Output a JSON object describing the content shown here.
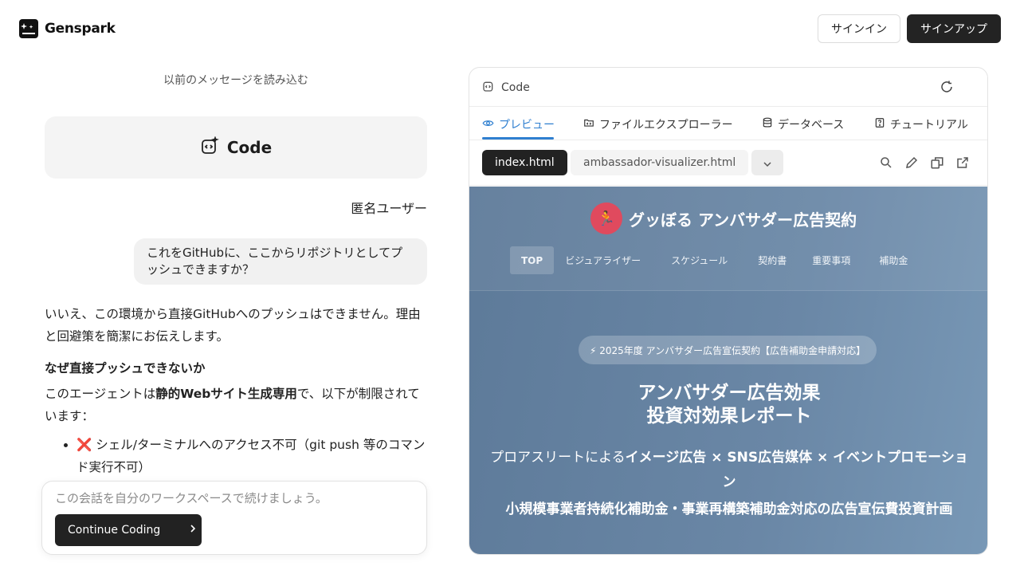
{
  "header": {
    "brand": "Genspark",
    "signin": "サインイン",
    "signup": "サインアップ"
  },
  "chat": {
    "load_previous": "以前のメッセージを読み込む",
    "code_card_label": "Code",
    "user_name": "匿名ユーザー",
    "user_message": "これをGitHubに、ここからリポジトリとしてプッシュできますか？",
    "answer_intro": "いいえ、この環境から直接GitHubへのプッシュはできません。理由と回避策を簡潔にお伝えします。",
    "answer_heading": "なぜ直接プッシュできないか",
    "answer_para_prefix": "このエージェントは",
    "answer_para_bold": "静的Webサイト生成専用",
    "answer_para_suffix": "で、以下が制限されています：",
    "bullets": [
      "❌ シェル/ターミナルへのアクセス不可（git push 等のコマンド実行不可）"
    ]
  },
  "continue": {
    "placeholder": "この会話を自分のワークスペースで続けましょう。",
    "button": "Continue Coding"
  },
  "panel": {
    "title": "Code",
    "tabs": [
      "プレビュー",
      "ファイルエクスプローラー",
      "データベース",
      "チュートリアル"
    ],
    "active_tab": "プレビュー",
    "files": [
      "index.html",
      "ambassador-visualizer.html"
    ],
    "active_file": "index.html"
  },
  "preview": {
    "brand": "グッぼる アンバサダー広告契約",
    "nav": [
      "TOP",
      "ビジュアライザー",
      "スケジュール",
      "契約書",
      "重要事項",
      "補助金"
    ],
    "pill": "⚡ 2025年度 アンバサダー広告宣伝契約【広告補助金申請対応】",
    "title_line1": "アンバサダー広告効果",
    "title_line2": "投資対効果レポート",
    "sub_prefix": "プロアスリートによる",
    "sub_bold": "イメージ広告 × SNS広告媒体 × イベントプロモーション",
    "sub2": "小規模事業者持続化補助金・事業再構築補助金対応の広告宣伝費投資計画"
  },
  "colors": {
    "accent": "#2f7fd0",
    "dark_button": "#222222",
    "preview_bg": "#6a87a6",
    "brand_badge": "#e04a5e"
  }
}
